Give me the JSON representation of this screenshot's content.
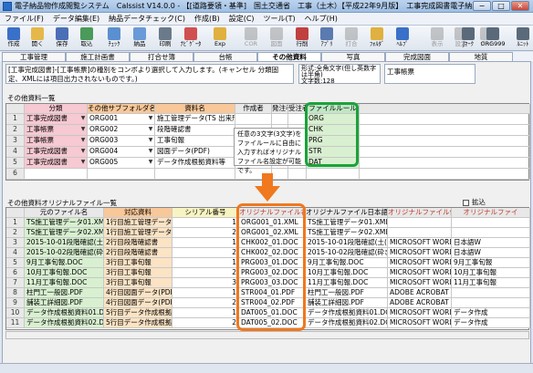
{
  "window": {
    "title": "電子納品物作成閲覧システム　Calssist V14.0.0 - 【[道路要領・基準]　国土交通省　工事（土木）【平成22年9月版】　工事完成図書電子納品】",
    "minimize": "−",
    "maximize": "□",
    "close": "✕"
  },
  "menu": [
    "ファイル(F)",
    "データ編集(E)",
    "納品データチェック(C)",
    "作成(B)",
    "設定(C)",
    "ツール(T)",
    "ヘルプ(H)"
  ],
  "toolbar": [
    {
      "label": "作成",
      "icon": "new-icon",
      "color": "#3a70c8",
      "enabled": true
    },
    {
      "label": "開く",
      "icon": "open-icon",
      "color": "#e6b84a",
      "enabled": true
    },
    {
      "label": "保存",
      "icon": "save-icon",
      "color": "#4a6fb5",
      "enabled": true
    },
    {
      "label": "取込",
      "icon": "import-icon",
      "color": "#4a9a5a",
      "enabled": true
    },
    {
      "label": "ﾁｪｯｸ",
      "icon": "check-icon",
      "color": "#5a8fd0",
      "enabled": true
    },
    {
      "label": "納品",
      "icon": "deliver-icon",
      "color": "#6a9ad8",
      "enabled": true
    },
    {
      "label": "印刷",
      "icon": "print-icon",
      "color": "#6a7a8a",
      "enabled": true
    },
    {
      "label": "ﾅﾋﾞｹﾞｰﾀ",
      "icon": "navigator-icon",
      "color": "#d05050",
      "enabled": true
    },
    {
      "label": "Exp",
      "icon": "explorer-icon",
      "color": "#e0b040",
      "enabled": true
    },
    {
      "label": "COR",
      "icon": "cor-icon",
      "color": "#8a8a8a",
      "enabled": false
    },
    {
      "label": "図面",
      "icon": "drawing-icon",
      "color": "#8a8a8a",
      "enabled": false
    },
    {
      "label": "行削",
      "icon": "delete-row-icon",
      "color": "#c04040",
      "enabled": true
    },
    {
      "label": "ｱﾌﾟﾘ",
      "icon": "app-icon",
      "color": "#5a7ab0",
      "enabled": true
    },
    {
      "label": "打合",
      "icon": "meeting-icon",
      "color": "#8a8a8a",
      "enabled": false
    },
    {
      "label": "ﾌｫﾙﾀﾞ",
      "icon": "folder-icon",
      "color": "#e0b040",
      "enabled": true
    },
    {
      "label": "ﾍﾙﾌﾟ",
      "icon": "help-icon",
      "color": "#3a70c8",
      "enabled": true
    },
    {
      "label": "表示",
      "icon": "view-icon",
      "color": "#8a8a8a",
      "enabled": false
    },
    {
      "label": "設定",
      "icon": "settings-icon",
      "color": "#8a8a8a",
      "enabled": false
    },
    {
      "label": "ﾌﾞｯｸ",
      "icon": "book-icon",
      "color": "#8a8a8a",
      "enabled": false
    },
    {
      "label": "Jﾏｰｸ",
      "icon": "jmark-icon",
      "color": "#5a6a7a",
      "enabled": true
    },
    {
      "label": "ORG999",
      "icon": "org999-icon",
      "color": "#5a6a7a",
      "enabled": true
    },
    {
      "label": "ﾙﾆｯﾄ",
      "icon": "unit-icon",
      "color": "#5a6a7a",
      "enabled": true
    }
  ],
  "tabs": [
    "工事管理",
    "施工計画書",
    "打合せ簿",
    "台帳",
    "その他資料",
    "写真",
    "完成図面",
    "地質"
  ],
  "active_tab": "その他資料",
  "note_text": "[工事完成図書]‐[工事帳票]の種別をコンボより選択して入力します。(キャンセル 分類固定、XMLには項目出力されないものです。)",
  "format_box": {
    "line1": "形式:全角文字(但し英数字は半角)",
    "line2": "文字数:128"
  },
  "work_name": "工事帳票",
  "section1_title": "その他資料一覧",
  "grid1": {
    "headers": [
      "分類",
      "その他サブフォルダ名",
      "資料名",
      "作成者",
      "発注者",
      "受注者",
      "ファイルルール"
    ],
    "rows": [
      {
        "no": "1",
        "class": "工事完成図書",
        "sub": "ORG001",
        "name": "施工管理データ(TS 出来形)",
        "rule": "ORG"
      },
      {
        "no": "2",
        "class": "工事帳票",
        "sub": "ORG002",
        "name": "段階確認書",
        "rule": "CHK"
      },
      {
        "no": "3",
        "class": "工事帳票",
        "sub": "ORG003",
        "name": "工事旬報",
        "rule": "PRG"
      },
      {
        "no": "4",
        "class": "工事完成図書",
        "sub": "ORG004",
        "name": "図面データ(PDF)",
        "rule": "STR"
      },
      {
        "no": "5",
        "class": "工事完成図書",
        "sub": "ORG005",
        "name": "データ作成根拠資料等",
        "rule": "DAT"
      },
      {
        "no": "6",
        "class": "",
        "sub": "",
        "name": "",
        "rule": ""
      }
    ]
  },
  "tooltip": "任意の3文字(3文字)をファイルールに自由に入力すればオリジナルファイル名設定が可能です。",
  "section2_title": "その他資料オリジナルファイル一覧",
  "checkbox_label": "拡込",
  "grid2": {
    "headers": [
      "元のファイル名",
      "対応資料",
      "シリアル番号",
      "オリジナルファイル名",
      "オリジナルファイル日本語名",
      "オリジナルファイル作",
      "オリジナルファイ"
    ],
    "rows": [
      {
        "no": "1",
        "src": "TS施工管理データ01.XML",
        "doc": "1行目施工管理データ(1",
        "serial": "1",
        "orig": "ORG001_01.XML",
        "jp": "TS施工管理データ01.XML",
        "app": "",
        "ver": ""
      },
      {
        "no": "2",
        "src": "TS施工管理データ02.XML",
        "doc": "1行目施工管理データ(1",
        "serial": "2",
        "orig": "ORG001_02.XML",
        "jp": "TS施工管理データ02.XML",
        "app": "",
        "ver": ""
      },
      {
        "no": "3",
        "src": "2015-10-01段階確認(土(管)",
        "doc": "2行目段階確認書",
        "serial": "1",
        "orig": "CHK002_01.DOC",
        "jp": "2015-10-01段階確認(土(管)",
        "app": "MICROSOFT WORD",
        "ver": "日本語W"
      },
      {
        "no": "4",
        "src": "2015-10-02段階確認(砕き作",
        "doc": "2行目段階確認書",
        "serial": "2",
        "orig": "CHK002_02.DOC",
        "jp": "2015-10-02段階確認(砕き作",
        "app": "MICROSOFT WORD",
        "ver": "日本語W"
      },
      {
        "no": "5",
        "src": "9月工事旬報.DOC",
        "doc": "3行目工事旬報",
        "serial": "1",
        "orig": "PRG003_01.DOC",
        "jp": "9月工事旬報.DOC",
        "app": "MICROSOFT WORD",
        "ver": "9月工事旬報"
      },
      {
        "no": "6",
        "src": "10月工事旬報.DOC",
        "doc": "3行目工事旬報",
        "serial": "2",
        "orig": "PRG003_02.DOC",
        "jp": "10月工事旬報.DOC",
        "app": "MICROSOFT WORD",
        "ver": "10月工事旬報"
      },
      {
        "no": "7",
        "src": "11月工事旬報.DOC",
        "doc": "3行目工事旬報",
        "serial": "3",
        "orig": "PRG003_03.DOC",
        "jp": "11月工事旬報.DOC",
        "app": "MICROSOFT WORD",
        "ver": "11月工事旬報"
      },
      {
        "no": "8",
        "src": "柱門工一般図.PDF",
        "doc": "4行目図面データ(PDF",
        "serial": "1",
        "orig": "STR004_01.PDF",
        "jp": "柱門工一般図.PDF",
        "app": "ADOBE ACROBAT",
        "ver": ""
      },
      {
        "no": "9",
        "src": "舗装工詳細図.PDF",
        "doc": "4行目図面データ(PDF",
        "serial": "2",
        "orig": "STR004_02.PDF",
        "jp": "舗装工詳細図.PDF",
        "app": "ADOBE ACROBAT",
        "ver": ""
      },
      {
        "no": "10",
        "src": "データ作成根拠資料01.DOC",
        "doc": "5行目データ作成根拠",
        "serial": "1",
        "orig": "DAT005_01.DOC",
        "jp": "データ作成根拠資料01.DOC",
        "app": "MICROSOFT WORD",
        "ver": "データ作成"
      },
      {
        "no": "11",
        "src": "データ作成根拠資料02.DOC",
        "doc": "5行目データ作成根拠",
        "serial": "2",
        "orig": "DAT005_02.DOC",
        "jp": "データ作成根拠資料02.DOC",
        "app": "MICROSOFT WORD",
        "ver": "データ作成"
      }
    ]
  },
  "colors": {
    "pink": "#f7c9d2",
    "orange_hd": "#f8c89a",
    "green_hd": "#bfe7c4",
    "highlight_green": "#1aa33a",
    "highlight_orange": "#f0781e",
    "yellow": "#f8f4c2",
    "lightgreen": "#d8f0d0",
    "lightorange": "#fbe3c4"
  }
}
